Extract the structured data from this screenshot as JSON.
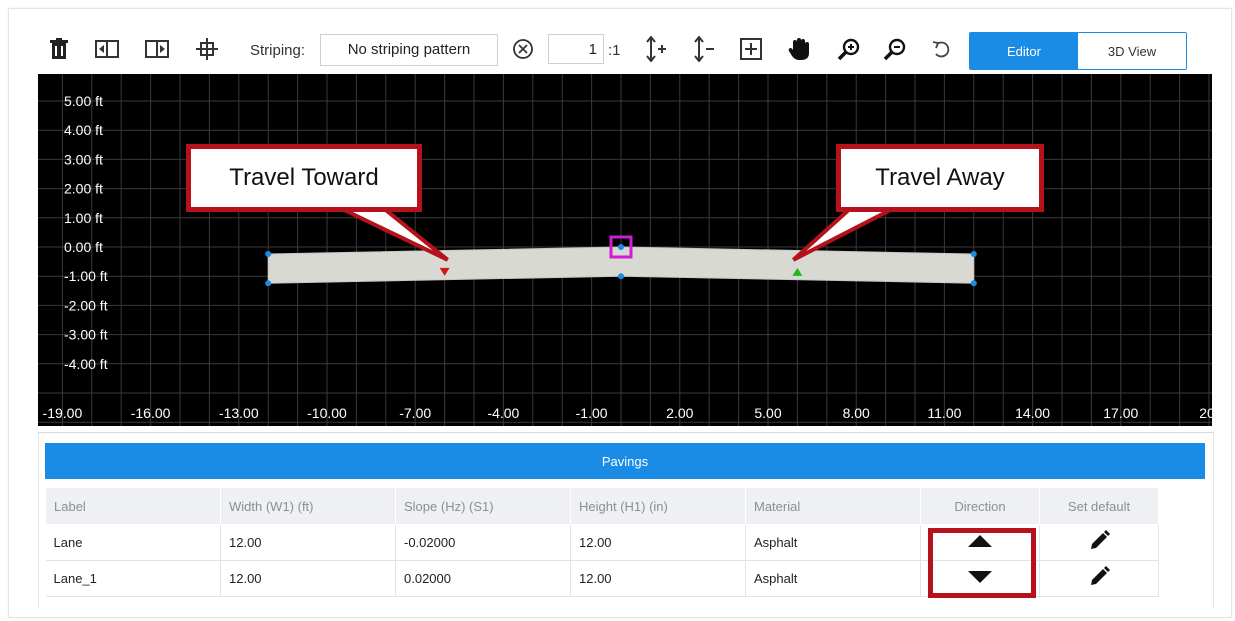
{
  "toolbar": {
    "icons": [
      "trash-icon",
      "insert-left-icon",
      "insert-right-icon",
      "crop-icon"
    ],
    "striping_label": "Striping:",
    "striping_value": "No striping pattern",
    "scale_value": "1",
    "scale_suffix": ":1",
    "tools": [
      "clear-icon",
      "increase-height-icon",
      "decrease-height-icon",
      "fit-view-icon",
      "pan-hand-icon",
      "zoom-in-icon",
      "zoom-out-icon",
      "undo-icon"
    ],
    "view_tabs": {
      "editor": "Editor",
      "view3d": "3D View"
    },
    "accent": "#1a8ce6"
  },
  "canvas": {
    "y_labels": [
      "5.00 ft",
      "4.00 ft",
      "3.00 ft",
      "2.00 ft",
      "1.00 ft",
      "0.00 ft",
      "-1.00 ft",
      "-2.00 ft",
      "-3.00 ft",
      "-4.00 ft"
    ],
    "x_labels": [
      "-19.00",
      "-16.00",
      "-13.00",
      "-10.00",
      "-7.00",
      "-4.00",
      "-1.00",
      "2.00",
      "5.00",
      "8.00",
      "11.00",
      "14.00",
      "17.00",
      "20."
    ],
    "callouts": {
      "left": "Travel Toward",
      "right": "Travel Away"
    },
    "callout_color": "#b5121b"
  },
  "pavings": {
    "title": "Pavings",
    "columns": [
      "Label",
      "Width (W1) (ft)",
      "Slope (Hz) (S1)",
      "Height (H1) (in)",
      "Material",
      "Direction",
      "Set default"
    ],
    "rows": [
      {
        "label": "Lane",
        "width": "12.00",
        "slope": "-0.02000",
        "height": "12.00",
        "material": "Asphalt",
        "direction": "up",
        "default": "pencil-icon"
      },
      {
        "label": "Lane_1",
        "width": "12.00",
        "slope": "0.02000",
        "height": "12.00",
        "material": "Asphalt",
        "direction": "down",
        "default": "pencil-icon"
      }
    ]
  }
}
